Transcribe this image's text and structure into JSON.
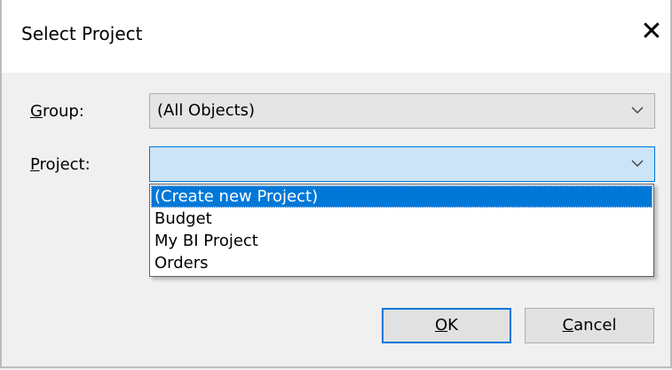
{
  "window": {
    "title": "Select Project",
    "close_glyph": "✕"
  },
  "form": {
    "group_label_accel": "G",
    "group_label_rest": "roup:",
    "group_value": "(All Objects)",
    "project_label_accel": "P",
    "project_label_rest": "roject:",
    "project_value": ""
  },
  "dropdown": {
    "options": [
      "(Create new Project)",
      "Budget",
      "My BI Project",
      "Orders"
    ],
    "selected_index": 0
  },
  "buttons": {
    "ok_accel": "O",
    "ok_rest": "K",
    "cancel_accel": "C",
    "cancel_rest": "ancel"
  },
  "colors": {
    "accent": "#0078d7",
    "focus_fill": "#cce4f7",
    "dialog_bg": "#f0f0f0"
  }
}
